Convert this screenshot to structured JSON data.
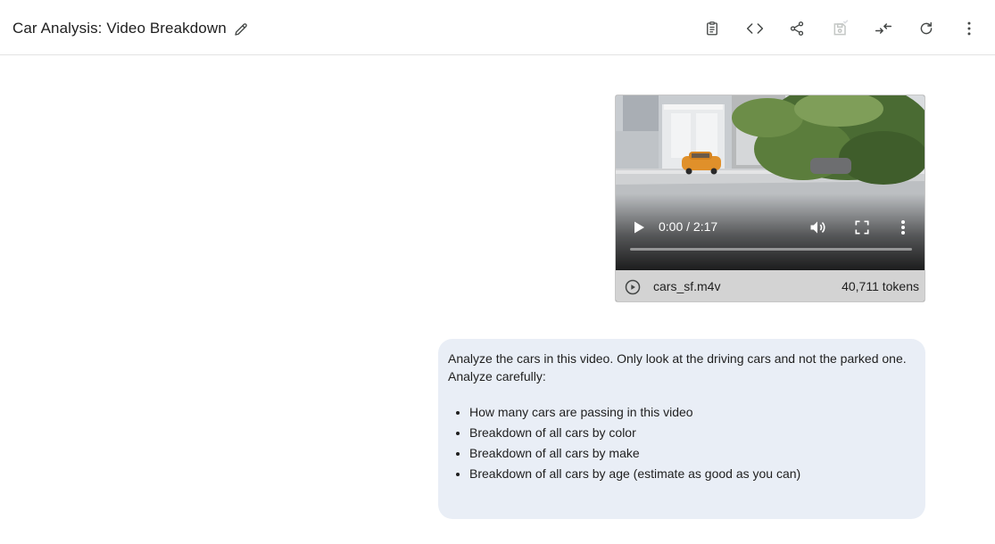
{
  "header": {
    "title": "Car Analysis: Video Breakdown",
    "icons": {
      "edit": "pencil-icon",
      "clipboard": "clipboard-icon",
      "code": "code-icon",
      "share": "share-icon",
      "save": "save-icon",
      "compare": "compare-icon",
      "refresh": "refresh-icon",
      "more": "more-vert-icon"
    }
  },
  "video": {
    "time": "0:00 / 2:17",
    "progress": 0,
    "file_name": "cars_sf.m4v",
    "tokens": "40,711 tokens"
  },
  "prompt": {
    "text": "Analyze the cars in this video. Only look at the driving cars and not the parked one. Analyze carefully:",
    "items": [
      "How many cars are passing in this video",
      "Breakdown of all cars by color",
      "Breakdown of all cars by make",
      "Breakdown of all cars by age (estimate as good as you can)"
    ]
  }
}
